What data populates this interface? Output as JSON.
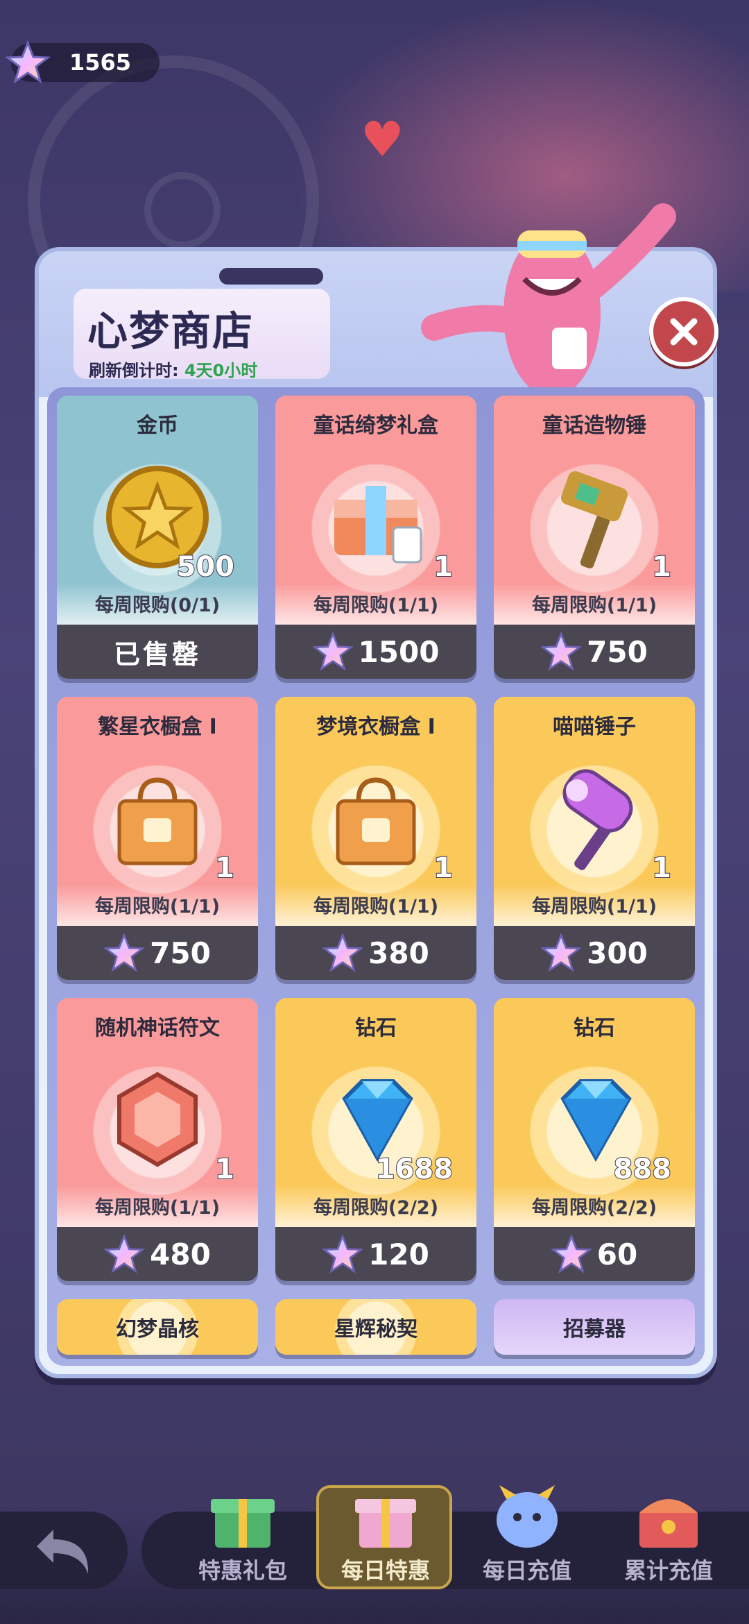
{
  "currency": {
    "icon": "rainbow-star-icon",
    "amount": "1565"
  },
  "shop": {
    "title": "心梦商店",
    "refresh_label": "刷新倒计时:",
    "refresh_value": "4天0小时",
    "close_icon": "close-icon"
  },
  "items": [
    {
      "name": "金币",
      "qty": "500",
      "limit": "每周限购(0/1)",
      "price": "",
      "status": "已售罄",
      "theme": "teal",
      "icon": "gold-coin-icon"
    },
    {
      "name": "童话绮梦礼盒",
      "qty": "1",
      "limit": "每周限购(1/1)",
      "price": "1500",
      "status": "",
      "theme": "red",
      "icon": "gift-box-icon"
    },
    {
      "name": "童话造物锤",
      "qty": "1",
      "limit": "每周限购(1/1)",
      "price": "750",
      "status": "",
      "theme": "red",
      "icon": "hammer-icon"
    },
    {
      "name": "繁星衣橱盒 I",
      "qty": "1",
      "limit": "每周限购(1/1)",
      "price": "750",
      "status": "",
      "theme": "red",
      "icon": "wardrobe-bag-icon"
    },
    {
      "name": "梦境衣橱盒 I",
      "qty": "1",
      "limit": "每周限购(1/1)",
      "price": "380",
      "status": "",
      "theme": "gold",
      "icon": "wardrobe-bag-icon"
    },
    {
      "name": "喵喵锤子",
      "qty": "1",
      "limit": "每周限购(1/1)",
      "price": "300",
      "status": "",
      "theme": "gold",
      "icon": "cat-hammer-icon"
    },
    {
      "name": "随机神话符文",
      "qty": "1",
      "limit": "每周限购(1/1)",
      "price": "480",
      "status": "",
      "theme": "red",
      "icon": "rune-icon"
    },
    {
      "name": "钻石",
      "qty": "1688",
      "limit": "每周限购(2/2)",
      "price": "120",
      "status": "",
      "theme": "gold",
      "icon": "diamond-icon"
    },
    {
      "name": "钻石",
      "qty": "888",
      "limit": "每周限购(2/2)",
      "price": "60",
      "status": "",
      "theme": "gold",
      "icon": "diamond-icon"
    }
  ],
  "partial_items": [
    {
      "name": "幻梦晶核",
      "theme": "gold"
    },
    {
      "name": "星辉秘契",
      "theme": "gold"
    },
    {
      "name": "招募器",
      "theme": "purple"
    }
  ],
  "nav": {
    "back_icon": "back-arrow-icon",
    "tabs": [
      {
        "label": "特惠礼包",
        "icon": "gift-icon",
        "active": false
      },
      {
        "label": "每日特惠",
        "icon": "daily-gift-icon",
        "active": true
      },
      {
        "label": "每日充值",
        "icon": "mascot-icon",
        "active": false
      },
      {
        "label": "累计充值",
        "icon": "treasure-icon",
        "active": false
      }
    ]
  },
  "colors": {
    "accent_green": "#2ea44f",
    "price_bar": "#4a4753",
    "close_red": "#c2474c"
  }
}
